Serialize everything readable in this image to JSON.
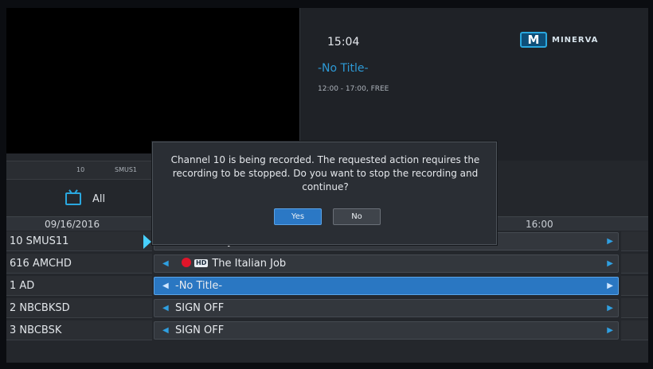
{
  "info": {
    "clock": "15:04",
    "brand": "MINERVA",
    "brand_mark": "M",
    "title": "-No Title-",
    "subtitle": "12:00 - 17:00, FREE"
  },
  "strip": {
    "number": "10",
    "name": "SMUS1"
  },
  "category": {
    "label": "All"
  },
  "dateband": {
    "date": "09/16/2016",
    "time": "16:00"
  },
  "rows": [
    {
      "channel": "10 SMUS11",
      "program": "Holiday Hits",
      "recording": true,
      "hd": false
    },
    {
      "channel": "616 AMCHD",
      "program": "The Italian Job",
      "recording": true,
      "hd": true,
      "hd_label": "HD"
    },
    {
      "channel": "1 AD",
      "program": "-No Title-",
      "recording": false,
      "hd": false,
      "selected": true
    },
    {
      "channel": "2 NBCBKSD",
      "program": "SIGN OFF",
      "recording": false,
      "hd": false
    },
    {
      "channel": "3 NBCBSK",
      "program": "SIGN OFF",
      "recording": false,
      "hd": false
    }
  ],
  "dialog": {
    "message": "Channel 10 is being recorded. The requested action requires the recording to be stopped. Do you want to stop the recording and continue?",
    "yes_label": "Yes",
    "no_label": "No"
  },
  "colors": {
    "accent": "#2b78c5",
    "record": "#e0152a",
    "title": "#2d9ad6"
  }
}
